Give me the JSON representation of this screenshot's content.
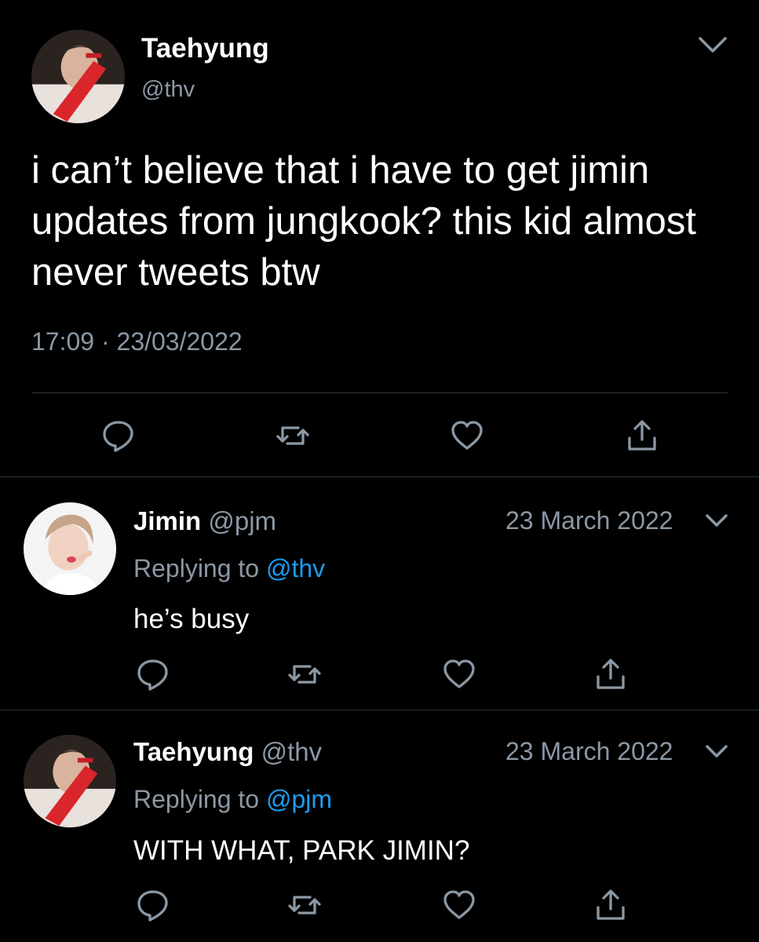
{
  "main_tweet": {
    "display_name": "Taehyung",
    "handle": "@thv",
    "text": "i can’t believe that i have to get jimin updates from jungkook? this kid almost never tweets btw",
    "timestamp": "17:09 · 23/03/2022",
    "avatar_icon": "profile-photo-taehyung",
    "menu_icon": "chevron-down-icon"
  },
  "replies": [
    {
      "display_name": "Jimin",
      "handle": "@pjm",
      "date": "23 March 2022",
      "replying_prefix": "Replying to",
      "replying_to": "@thv",
      "text": "he’s busy",
      "avatar_icon": "profile-photo-jimin"
    },
    {
      "display_name": "Taehyung",
      "handle": "@thv",
      "date": "23 March 2022",
      "replying_prefix": "Replying to",
      "replying_to": "@pjm",
      "text": "WITH WHAT, PARK JIMIN?",
      "avatar_icon": "profile-photo-taehyung"
    }
  ],
  "actions": [
    "reply-icon",
    "retweet-icon",
    "like-icon",
    "share-icon"
  ],
  "colors": {
    "background": "#000000",
    "text": "#ffffff",
    "secondary_text": "#8b98a5",
    "link": "#1d9bf0",
    "divider": "#2f3336"
  }
}
